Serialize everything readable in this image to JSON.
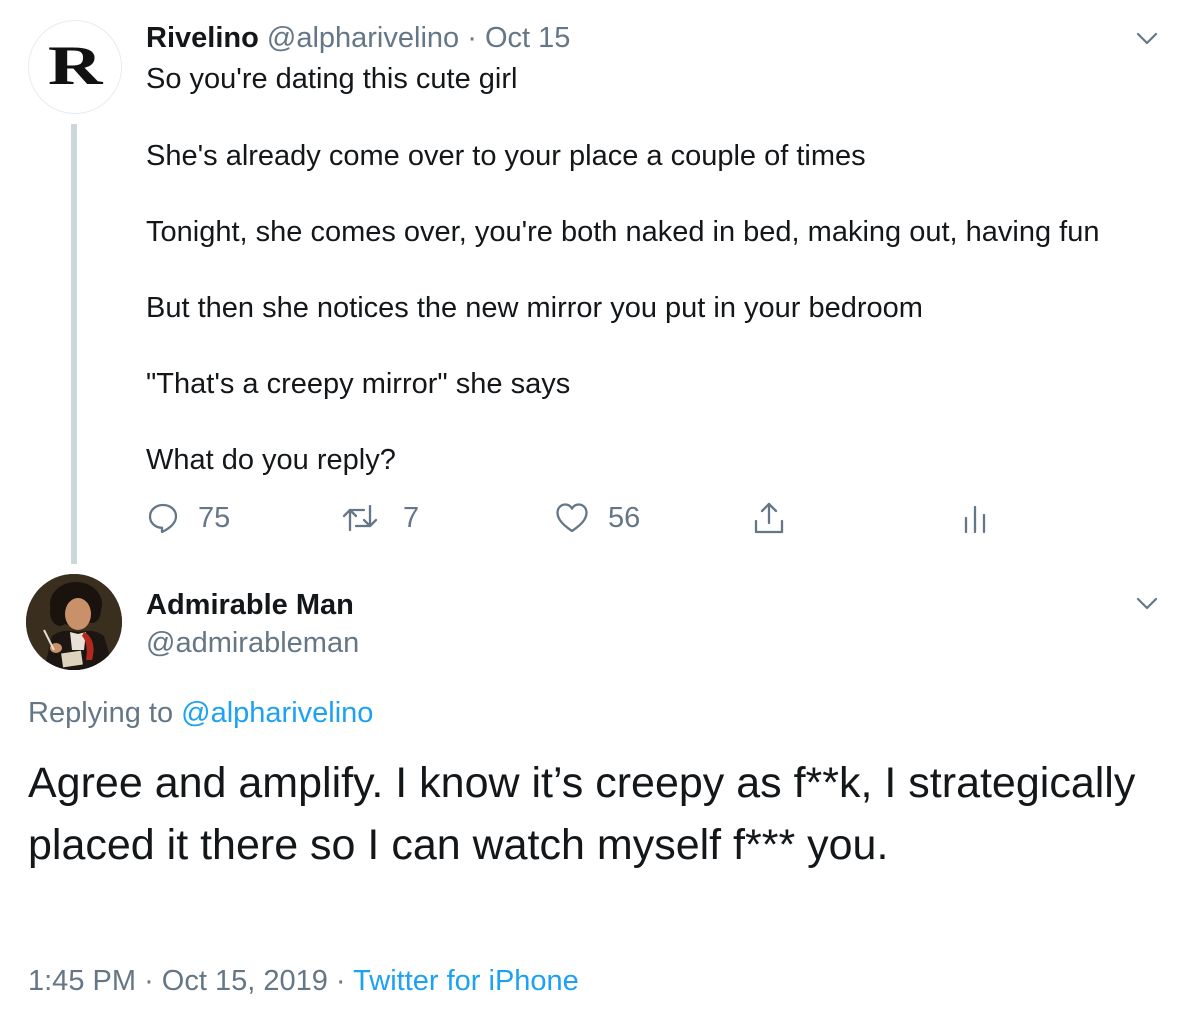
{
  "parent_tweet": {
    "avatar_letter": "R",
    "name": "Rivelino",
    "handle": "@alpharivelino",
    "separator": "·",
    "date": "Oct 15",
    "paragraphs": [
      "So you're dating this cute girl",
      "She's already come over to your place a couple of times",
      "Tonight, she comes over, you're both naked in bed, making out, having fun",
      "But then she notices the new mirror you put in your bedroom",
      "\"That's a creepy mirror\" she says",
      "What do you reply?"
    ],
    "actions": {
      "replies": "75",
      "retweets": "7",
      "likes": "56"
    },
    "icons": [
      "chevron-down-icon",
      "reply-icon",
      "retweet-icon",
      "like-icon",
      "share-icon",
      "analytics-icon"
    ]
  },
  "reply_tweet": {
    "name": "Admirable Man",
    "handle": "@admirableman",
    "replying_prefix": "Replying to",
    "replying_handle": "@alpharivelino",
    "text": "Agree and amplify. I know it’s creepy as f**k, I strategically placed it there so I can watch myself f*** you.",
    "time": "1:45 PM",
    "separator": "·",
    "date": "Oct 15, 2019",
    "separator2": "·",
    "source": "Twitter for iPhone"
  },
  "colors": {
    "text": "#14171a",
    "muted": "#657786",
    "link": "#1da1f2",
    "thread_line": "#ccd6dd"
  }
}
